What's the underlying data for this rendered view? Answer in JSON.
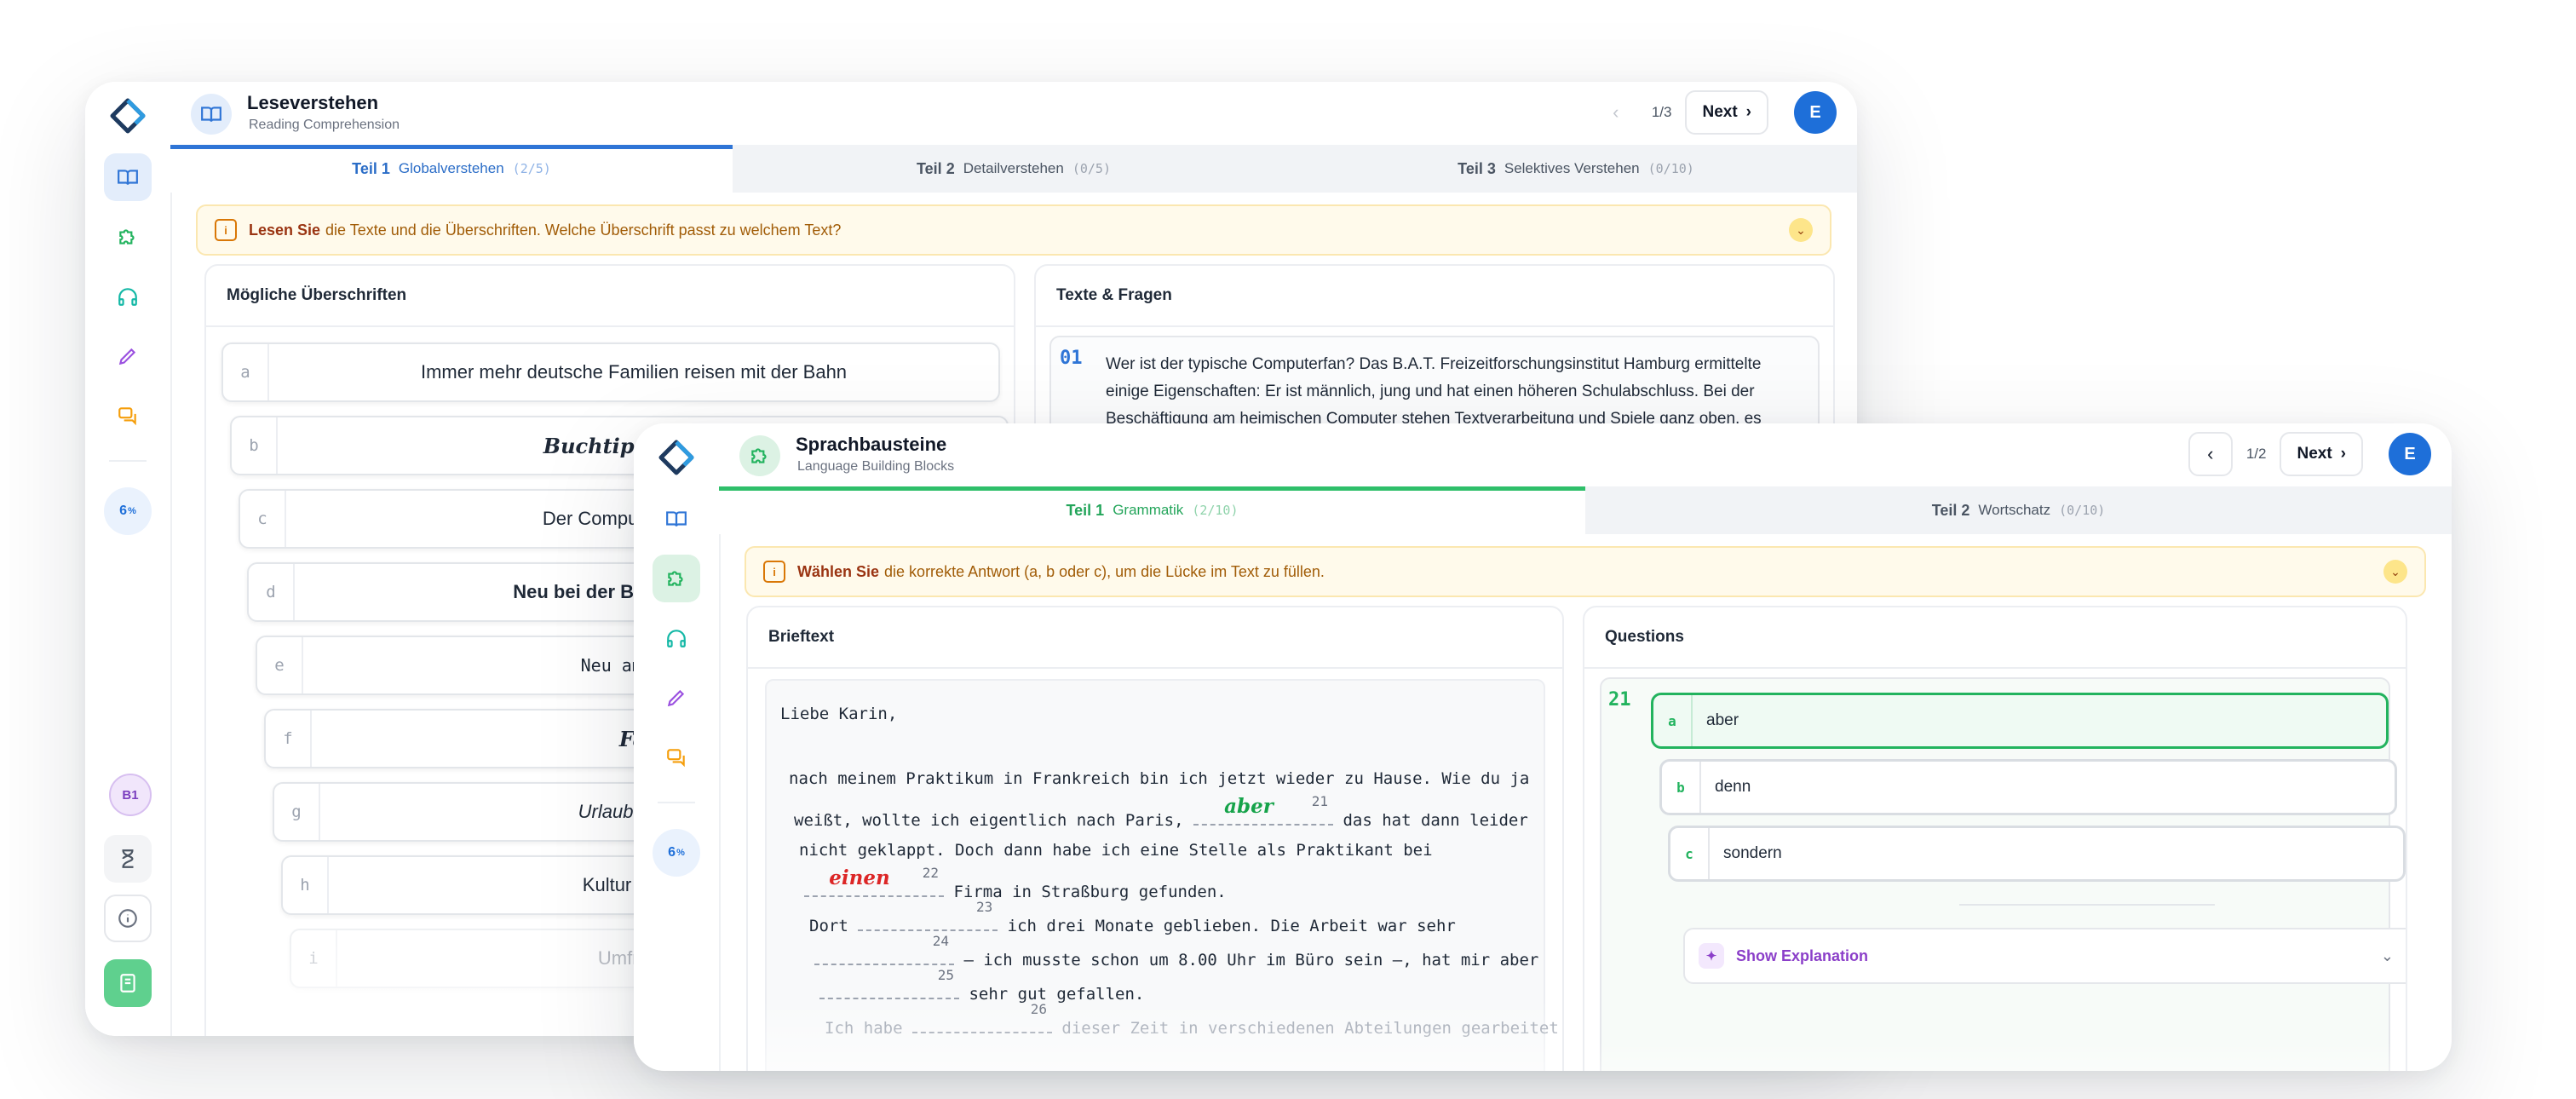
{
  "window_back": {
    "header": {
      "title": "Leseverstehen",
      "subtitle": "Reading Comprehension",
      "counter": "1/3",
      "next_label": "Next",
      "avatar_initial": "E"
    },
    "tabs": [
      {
        "part": "Teil 1",
        "label": "Globalverstehen",
        "count": "(2/5)",
        "active": true
      },
      {
        "part": "Teil 2",
        "label": "Detailverstehen",
        "count": "(0/5)",
        "active": false
      },
      {
        "part": "Teil 3",
        "label": "Selektives Verstehen",
        "count": "(0/10)",
        "active": false
      }
    ],
    "instruction": {
      "bold": "Lesen Sie",
      "text": "die Texte und die Überschriften. Welche Überschrift passt zu welchem Text?"
    },
    "headings_panel": {
      "title": "Mögliche Überschriften",
      "items": [
        {
          "letter": "a",
          "text": "Immer mehr deutsche Familien reisen mit der Bahn"
        },
        {
          "letter": "b",
          "text": "Buchtipp: Hilfe b"
        },
        {
          "letter": "c",
          "text": "Der Computer: Liebstes H"
        },
        {
          "letter": "d",
          "text": "Neu bei der Bahn: Spezielle Infor"
        },
        {
          "letter": "e",
          "text": "Neu am Markt: Bil"
        },
        {
          "letter": "f",
          "text": "Familien i"
        },
        {
          "letter": "g",
          "text": "Urlaub mit dem Fahrrad ir"
        },
        {
          "letter": "h",
          "text": "Kultur im Urlaub: Interesse"
        },
        {
          "letter": "i",
          "text": "Umfrage: Wer verwendet"
        }
      ]
    },
    "texts_panel": {
      "title": "Texte & Fragen",
      "question_number": "01",
      "lines": [
        "Wer ist der typische Computerfan? Das B.A.T. Freizeitforschungsinstitut Hamburg ermittelte",
        "einige Eigenschaften: Er ist männlich, jung und hat einen höheren Schulabschluss. Bei der",
        "Beschäftigung am heimischen Computer stehen Textverarbeitung und Spiele ganz oben, es"
      ]
    },
    "sidebar": {
      "progress": "6",
      "progress_unit": "%",
      "level": "B1"
    }
  },
  "window_front": {
    "header": {
      "title": "Sprachbausteine",
      "subtitle": "Language Building Blocks",
      "counter": "1/2",
      "next_label": "Next",
      "avatar_initial": "E"
    },
    "tabs": [
      {
        "part": "Teil 1",
        "label": "Grammatik",
        "count": "(2/10)",
        "active": true
      },
      {
        "part": "Teil 2",
        "label": "Wortschatz",
        "count": "(0/10)",
        "active": false
      }
    ],
    "instruction": {
      "bold": "Wählen Sie",
      "text": "die korrekte Antwort (a, b oder c), um die Lücke im Text zu füllen."
    },
    "letter_panel": {
      "title": "Brieftext",
      "greeting": "Liebe Karin,",
      "lines": [
        {
          "before": "nach meinem Praktikum in Frankreich bin ich jetzt wieder zu Hause. Wie du ja",
          "gap": null,
          "after": ""
        },
        {
          "before": "weißt, wollte ich eigentlich nach Paris,",
          "gap": {
            "num": "21",
            "answer": "aber",
            "color": "#16a34a"
          },
          "after": "das hat dann leider"
        },
        {
          "before": "nicht geklappt. Doch dann habe ich eine Stelle als Praktikant bei",
          "gap": null,
          "after": ""
        },
        {
          "before": "",
          "gap": {
            "num": "22",
            "answer": "einen",
            "color": "#dc2626"
          },
          "after": "Firma in Straßburg gefunden."
        },
        {
          "before": "Dort",
          "gap": {
            "num": "23",
            "answer": "",
            "color": "#6b7280"
          },
          "after": "ich drei Monate geblieben. Die Arbeit war sehr"
        },
        {
          "before": "",
          "gap": {
            "num": "24",
            "answer": "",
            "color": "#6b7280"
          },
          "after": "– ich musste schon um 8.00 Uhr im Büro sein –, hat mir aber"
        },
        {
          "before": "",
          "gap": {
            "num": "25",
            "answer": "",
            "color": "#6b7280"
          },
          "after": "sehr gut gefallen."
        },
        {
          "before": "Ich habe",
          "gap": {
            "num": "26",
            "answer": "",
            "color": "#6b7280"
          },
          "after": "dieser Zeit in verschiedenen Abteilungen gearbeitet"
        }
      ]
    },
    "questions_panel": {
      "title": "Questions",
      "question_number": "21",
      "options": [
        {
          "letter": "a",
          "text": "aber",
          "selected": true
        },
        {
          "letter": "b",
          "text": "denn",
          "selected": false
        },
        {
          "letter": "c",
          "text": "sondern",
          "selected": false
        }
      ],
      "explanation_label": "Show Explanation"
    },
    "sidebar": {
      "progress": "6",
      "progress_unit": "%"
    }
  },
  "colors": {
    "accent_blue": "#1e6fd9",
    "accent_green": "#22b35e",
    "warning_bg": "#fffaeb",
    "correct": "#16a34a",
    "wrong": "#dc2626"
  }
}
